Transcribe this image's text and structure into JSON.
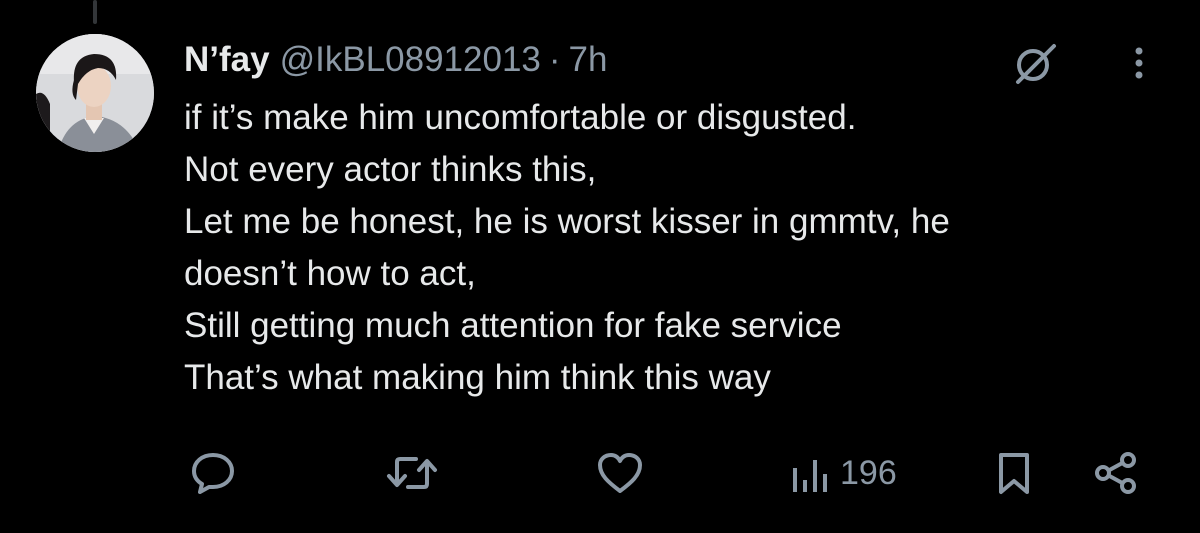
{
  "tweet": {
    "display_name": "N’fay",
    "handle": "@IkBL08912013",
    "separator": "·",
    "time": "7h",
    "lines": [
      "if it’s make him uncomfortable or disgusted.",
      "Not every actor thinks this,",
      "Let me be honest, he is worst kisser in gmmtv, he",
      "doesn’t how to act,",
      "Still getting much attention for fake service",
      "That’s what making him think this way"
    ]
  },
  "actions": {
    "views": "196"
  },
  "icons": {
    "reply": "reply-icon",
    "retweet": "retweet-icon",
    "like": "heart-icon",
    "views": "views-chart-icon",
    "bookmark": "bookmark-icon",
    "share": "share-icon",
    "grok": "grok-icon",
    "more": "more-icon"
  },
  "colors": {
    "background": "#000000",
    "primary_text": "#e7e9ea",
    "secondary_text": "#8b98a5",
    "thread_line": "#333639"
  }
}
